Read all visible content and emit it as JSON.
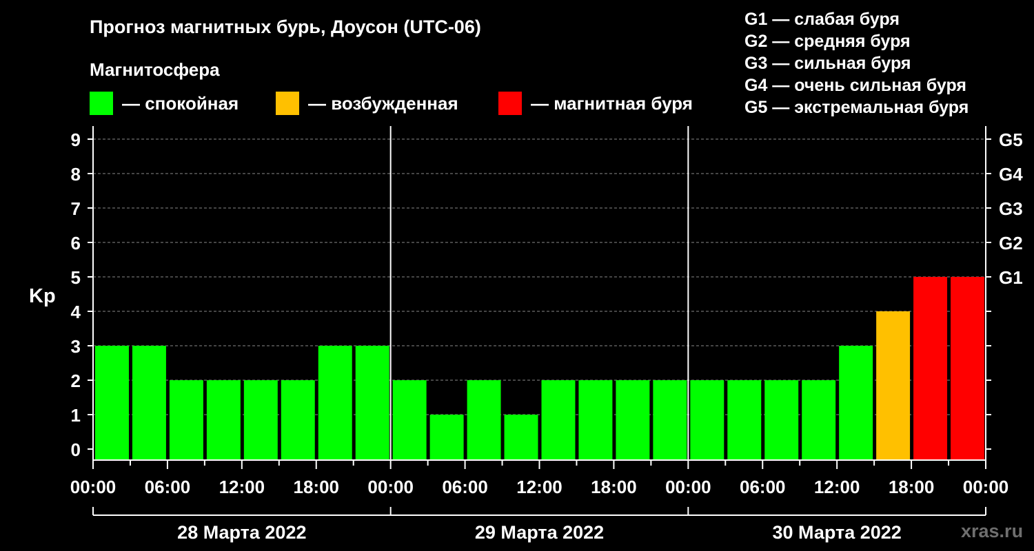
{
  "title": "Прогноз магнитных бурь, Доусон (UTC-06)",
  "magnetosphere_label": "Магнитосфера",
  "legend": [
    {
      "label": "— спокойная",
      "color": "#00ff00"
    },
    {
      "label": "— возбужденная",
      "color": "#ffc000"
    },
    {
      "label": "— магнитная буря",
      "color": "#ff0000"
    }
  ],
  "g_legend": [
    "G1 — слабая буря",
    "G2 — средняя буря",
    "G3 — сильная буря",
    "G4 — очень сильная буря",
    "G5 — экстремальная буря"
  ],
  "watermark": "xras.ru",
  "chart_data": {
    "type": "bar",
    "ylabel": "Kp",
    "ylim": [
      0,
      9
    ],
    "y_ticks": [
      "0",
      "1",
      "2",
      "3",
      "4",
      "5",
      "6",
      "7",
      "8",
      "9"
    ],
    "right_ticks": [
      {
        "value": 5,
        "label": "G1"
      },
      {
        "value": 6,
        "label": "G2"
      },
      {
        "value": 7,
        "label": "G3"
      },
      {
        "value": 8,
        "label": "G4"
      },
      {
        "value": 9,
        "label": "G5"
      }
    ],
    "x_tick_labels": [
      "00:00",
      "06:00",
      "12:00",
      "18:00",
      "00:00",
      "06:00",
      "12:00",
      "18:00",
      "00:00",
      "06:00",
      "12:00",
      "18:00",
      "00:00"
    ],
    "days": [
      "28 Марта 2022",
      "29 Марта 2022",
      "30 Марта 2022"
    ],
    "interval_hours": 3,
    "values": [
      3,
      3,
      2,
      2,
      2,
      2,
      3,
      3,
      2,
      1,
      2,
      1,
      2,
      2,
      2,
      2,
      2,
      2,
      2,
      2,
      3,
      4,
      5,
      5
    ],
    "colors": {
      "quiet": "#00ff00",
      "active": "#ffc000",
      "storm": "#ff0000"
    },
    "grid": "dashed horizontal"
  }
}
